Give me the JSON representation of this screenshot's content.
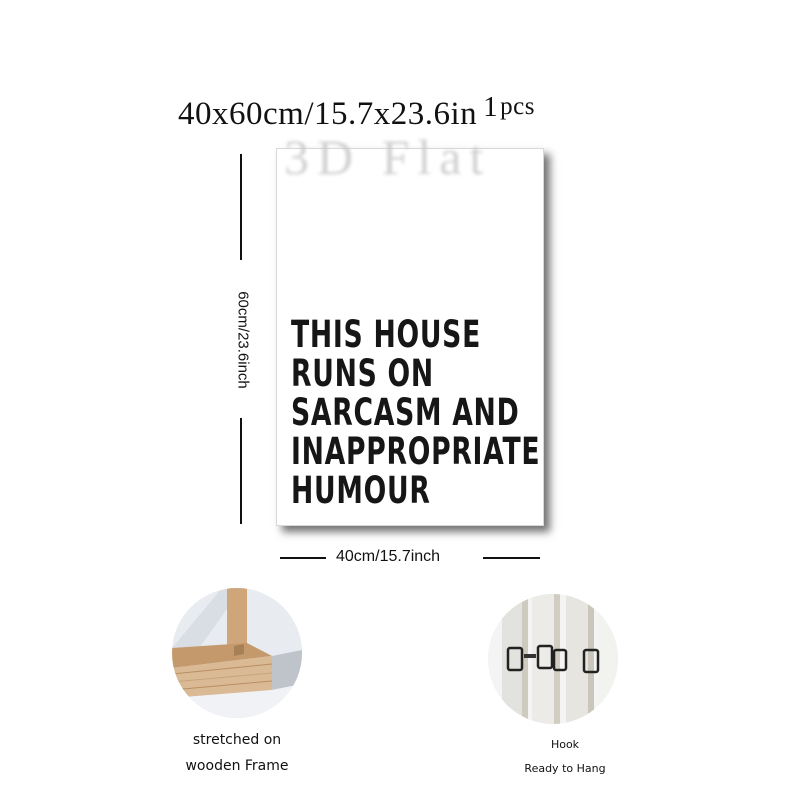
{
  "header": {
    "size_text": "40x60cm/15.7x23.6in",
    "quantity": "1",
    "quantity_unit": "pcs"
  },
  "watermark": {
    "text": "3D Flat"
  },
  "poster": {
    "lines": [
      "THIS HOUSE",
      "RUNS ON",
      "SARCASM AND",
      "INAPPROPRIATE",
      "HUMOUR"
    ]
  },
  "dimensions": {
    "height_label": "60cm/23.6inch",
    "width_label": "40cm/15.7inch"
  },
  "features": {
    "frame": {
      "icon": "wooden-frame-photo",
      "line1": "stretched on",
      "line2": "wooden Frame"
    },
    "hook": {
      "icon": "hook-photo",
      "line1": "Hook",
      "line2": "Ready to Hang"
    }
  },
  "colors": {
    "text": "#111111",
    "canvas": "#ffffff",
    "wood": "#d6b48a",
    "watermark": "#c9c9c9"
  }
}
